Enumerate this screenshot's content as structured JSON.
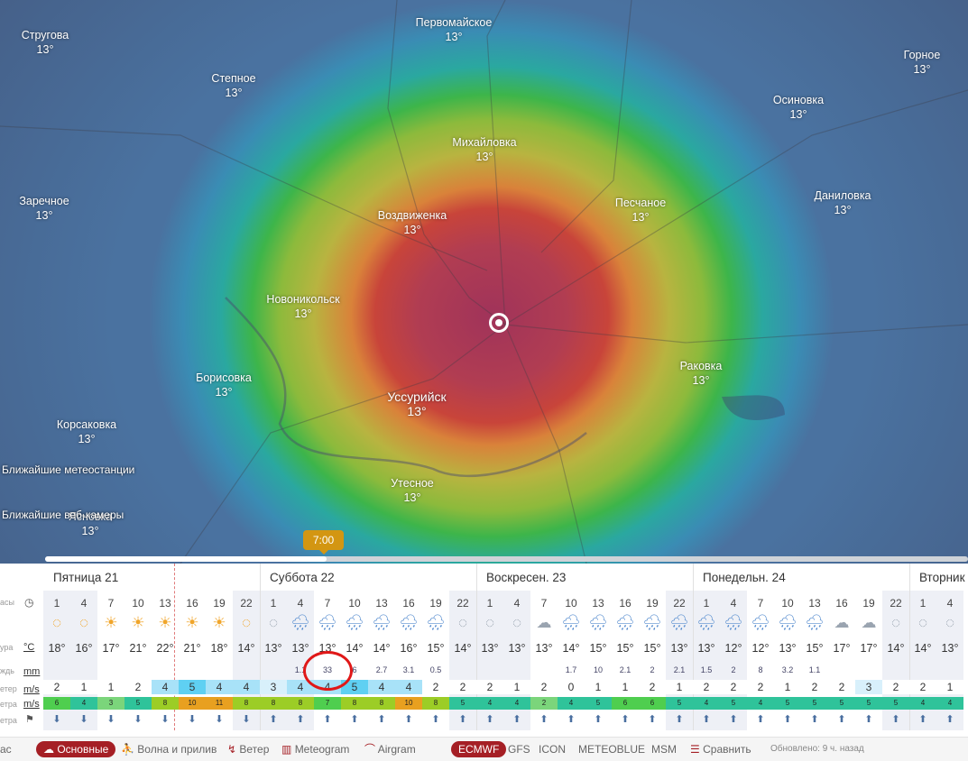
{
  "cities": [
    {
      "name": "Первомайское",
      "temp": "13°"
    },
    {
      "name": "Стругова",
      "temp": "13°"
    },
    {
      "name": "Степное",
      "temp": "13°"
    },
    {
      "name": "Горное",
      "temp": "13°"
    },
    {
      "name": "Осиновка",
      "temp": "13°"
    },
    {
      "name": "Михайловка",
      "temp": "13°"
    },
    {
      "name": "Заречное",
      "temp": "13°"
    },
    {
      "name": "Воздвиженка",
      "temp": "13°"
    },
    {
      "name": "Песчаное",
      "temp": "13°"
    },
    {
      "name": "Даниловка",
      "temp": "13°"
    },
    {
      "name": "Новоникольск",
      "temp": "13°"
    },
    {
      "name": "Раковка",
      "temp": "13°"
    },
    {
      "name": "Борисовка",
      "temp": "13°"
    },
    {
      "name": "Уссурийск",
      "temp": "13°"
    },
    {
      "name": "Корсаковка",
      "temp": "13°"
    },
    {
      "name": "Утесное",
      "temp": "13°"
    },
    {
      "name": "Ясновка",
      "temp": "13°"
    }
  ],
  "links": {
    "stations": "Ближайшие метеостанции",
    "webcams": "Ближайшие веб-камеры"
  },
  "timeline": {
    "time": "7:00"
  },
  "days": [
    "Пятница 21",
    "Суббота 22",
    "Воскресен. 23",
    "Понедельн. 24",
    "Вторник"
  ],
  "labels": {
    "hours": "асы",
    "temp": "ура",
    "temp_unit": "°C",
    "rain": "ждь",
    "rain_unit": "mm",
    "wind": "етер",
    "wind_unit": "m/s",
    "gust": "етра",
    "gust_unit": "m/s",
    "dir": "етра"
  },
  "hours": [
    "1",
    "4",
    "7",
    "10",
    "13",
    "16",
    "19",
    "22",
    "1",
    "4",
    "7",
    "10",
    "13",
    "16",
    "19",
    "22",
    "1",
    "4",
    "7",
    "10",
    "13",
    "16",
    "19",
    "22",
    "1",
    "4",
    "7",
    "10",
    "13",
    "16",
    "19",
    "22",
    "1",
    "4"
  ],
  "temps": [
    "18°",
    "16°",
    "17°",
    "21°",
    "22°",
    "21°",
    "18°",
    "14°",
    "13°",
    "13°",
    "13°",
    "14°",
    "14°",
    "16°",
    "15°",
    "14°",
    "13°",
    "13°",
    "13°",
    "14°",
    "15°",
    "15°",
    "15°",
    "13°",
    "13°",
    "12°",
    "12°",
    "13°",
    "15°",
    "17°",
    "17°",
    "14°",
    "14°",
    "13°"
  ],
  "rain": [
    "",
    "",
    "",
    "",
    "",
    "",
    "",
    "",
    "",
    "1.1",
    "33",
    "6",
    "2.7",
    "3.1",
    "0.5",
    "",
    "",
    "",
    "",
    "1.7",
    "10",
    "2.1",
    "2",
    "2.1",
    "1.5",
    "2",
    "8",
    "3.2",
    "1.1",
    "",
    "",
    "",
    "",
    ""
  ],
  "wind": [
    "2",
    "1",
    "1",
    "2",
    "4",
    "5",
    "4",
    "4",
    "3",
    "4",
    "4",
    "5",
    "4",
    "4",
    "2",
    "2",
    "2",
    "1",
    "2",
    "0",
    "1",
    "1",
    "2",
    "1",
    "2",
    "2",
    "2",
    "1",
    "2",
    "2",
    "3",
    "2",
    "2",
    "1"
  ],
  "gusts": [
    "6",
    "4",
    "3",
    "5",
    "8",
    "10",
    "11",
    "8",
    "8",
    "8",
    "7",
    "8",
    "8",
    "10",
    "8",
    "5",
    "4",
    "4",
    "2",
    "4",
    "5",
    "6",
    "6",
    "5",
    "4",
    "5",
    "4",
    "5",
    "5",
    "5",
    "5",
    "5",
    "4",
    "4"
  ],
  "bottom": {
    "main": "Основные",
    "waves": "Волна и прилив",
    "wind": "Ветер",
    "meteogram": "Meteogram",
    "airgram": "Airgram",
    "ecmwf": "ECMWF",
    "gfs": "GFS",
    "icon": "ICON",
    "meteoblue": "METEOBLUE",
    "msm": "MSM",
    "compare": "Сравнить",
    "updated": "Обновлено: 9 ч. назад"
  },
  "colors": {
    "accent": "#a51f25",
    "timeline": "#d39612"
  }
}
